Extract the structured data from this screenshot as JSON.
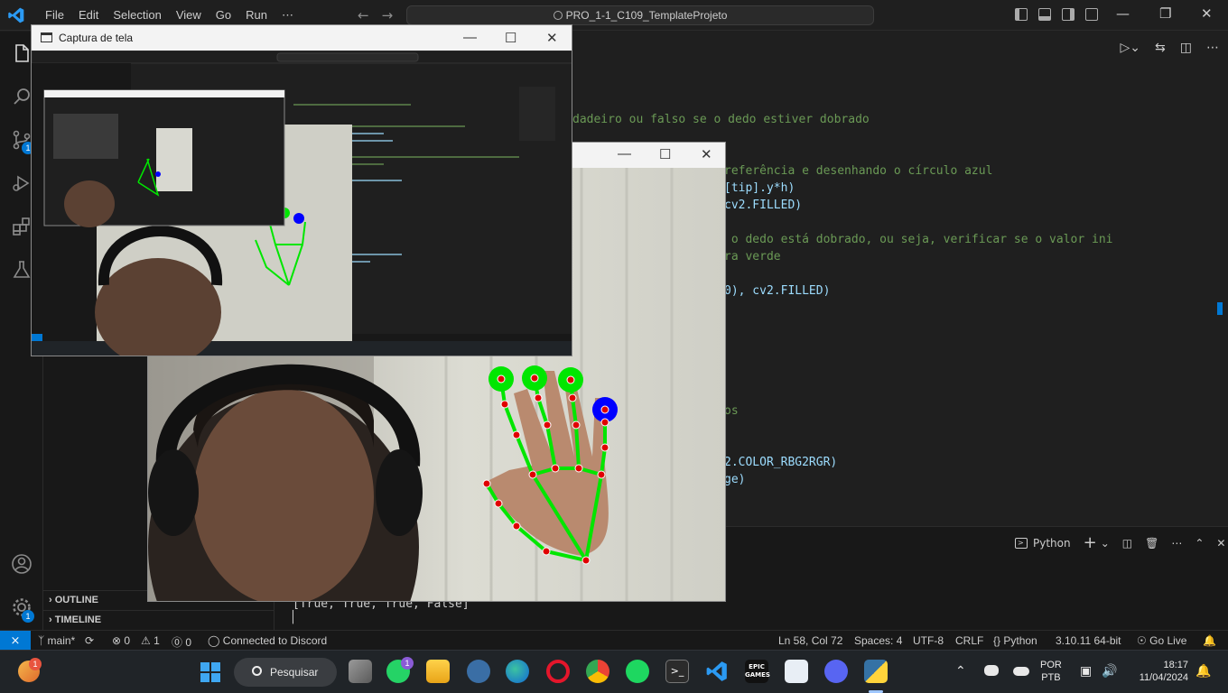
{
  "titlebar": {
    "menu": [
      "File",
      "Edit",
      "Selection",
      "View",
      "Go",
      "Run",
      "⋯"
    ],
    "nav_back": "←",
    "nav_forward": "→",
    "command_center": "PRO_1-1_C109_TemplateProjeto",
    "minimize": "—",
    "maximize": "❐",
    "close": "✕"
  },
  "activity": {
    "explorer_badge": "",
    "scm_badge": "1",
    "settings_badge": "1"
  },
  "sidebar": {
    "outline": "OUTLINE",
    "timeline": "TIMELINE"
  },
  "editor": {
    "lines": [
      {
        "text": "dadeiro ou falso se o dedo estiver dobrado",
        "color": "#6a9955"
      },
      {
        "text": "referência e desenhando o círculo azul",
        "color": "#6a9955"
      },
      {
        "text": "[tip].y*h)",
        "color": "#9cdcfe"
      },
      {
        "text": "cv2.FILLED)",
        "color": "#9cdcfe"
      },
      {
        "text": " o dedo está dobrado, ou seja, verificar se o valor ini",
        "color": "#6a9955"
      },
      {
        "text": "ra verde",
        "color": "#6a9955"
      },
      {
        "text": "0), cv2.FILLED)",
        "color": "#9cdcfe"
      },
      {
        "text": "os",
        "color": "#6a9955"
      },
      {
        "text": "2.COLOR_RBG2RGR)",
        "color": "#9cdcfe"
      },
      {
        "text": "ge)",
        "color": "#9cdcfe"
      }
    ]
  },
  "panel": {
    "terminal_label": "Python",
    "plus": "+",
    "chevron": "⌄",
    "output_line": "[True, True, True, False]",
    "cursor": "▏"
  },
  "statusbar": {
    "remote": "⨯",
    "branch": "main*",
    "sync": "⟳",
    "errors": "⊗ 0",
    "warnings": "⚠ 1",
    "ports": "⓪ 0",
    "discord": "Connected to Discord",
    "cursor_pos": "Ln 58, Col 72",
    "spaces": "Spaces: 4",
    "encoding": "UTF-8",
    "eol": "CRLF",
    "language": "Python",
    "interpreter": "3.10.11 64-bit",
    "golive": "Go Live"
  },
  "taskbar": {
    "search": "Pesquisar",
    "whatsapp_badge": "1",
    "epic_label": "EPIC\nGAMES",
    "lang_line1": "POR",
    "lang_line2": "PTB",
    "time": "18:17",
    "date": "11/04/2024"
  },
  "capture_window": {
    "title": "Captura de tela",
    "minimize": "—",
    "maximize": "☐",
    "close": "✕"
  },
  "colors": {
    "accent": "#0078d4",
    "landmark_green": "#00e600",
    "landmark_red": "#e00000",
    "landmark_blue": "#0000ff"
  }
}
